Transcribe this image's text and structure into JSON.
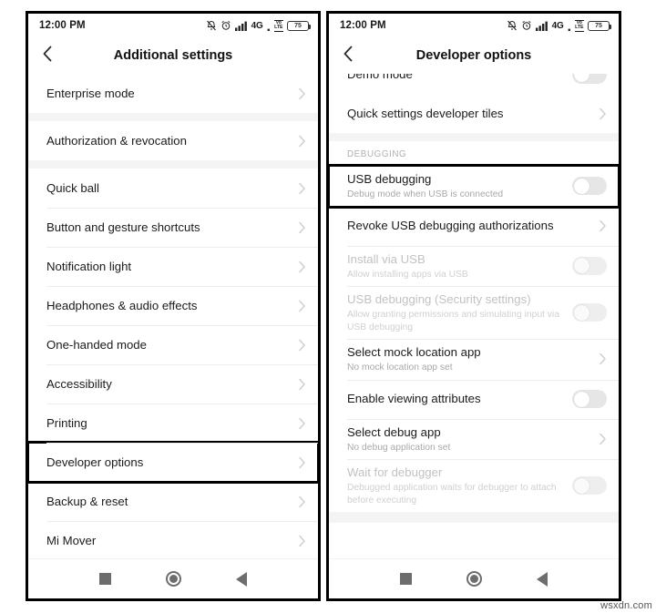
{
  "watermark": "wsxdn.com",
  "status_bar": {
    "time": "12:00 PM",
    "network": "4G",
    "volte_top": "Vo",
    "volte_bottom": "LTE",
    "battery_level": "75",
    "icons": [
      "mute-icon",
      "alarm-icon",
      "signal-bars-icon",
      "volte-icon",
      "battery-icon"
    ]
  },
  "left_phone": {
    "title": "Additional settings",
    "back_label": "Back",
    "groups": [
      {
        "rows": [
          {
            "title": "Enterprise mode",
            "sub": "",
            "accessory": "chevron",
            "disabled": false,
            "highlighted": false
          }
        ]
      },
      {
        "rows": [
          {
            "title": "Authorization & revocation",
            "sub": "",
            "accessory": "chevron",
            "disabled": false,
            "highlighted": false
          }
        ]
      },
      {
        "rows": [
          {
            "title": "Quick ball",
            "sub": "",
            "accessory": "chevron",
            "disabled": false,
            "highlighted": false
          },
          {
            "title": "Button and gesture shortcuts",
            "sub": "",
            "accessory": "chevron",
            "disabled": false,
            "highlighted": false
          },
          {
            "title": "Notification light",
            "sub": "",
            "accessory": "chevron",
            "disabled": false,
            "highlighted": false
          },
          {
            "title": "Headphones & audio effects",
            "sub": "",
            "accessory": "chevron",
            "disabled": false,
            "highlighted": false
          },
          {
            "title": "One-handed mode",
            "sub": "",
            "accessory": "chevron",
            "disabled": false,
            "highlighted": false
          },
          {
            "title": "Accessibility",
            "sub": "",
            "accessory": "chevron",
            "disabled": false,
            "highlighted": false
          },
          {
            "title": "Printing",
            "sub": "",
            "accessory": "chevron",
            "disabled": false,
            "highlighted": false
          },
          {
            "title": "Developer options",
            "sub": "",
            "accessory": "chevron",
            "disabled": false,
            "highlighted": true
          },
          {
            "title": "Backup & reset",
            "sub": "",
            "accessory": "chevron",
            "disabled": false,
            "highlighted": false
          },
          {
            "title": "Mi Mover",
            "sub": "",
            "accessory": "chevron",
            "disabled": false,
            "highlighted": false
          }
        ]
      }
    ]
  },
  "right_phone": {
    "title": "Developer options",
    "back_label": "Back",
    "clipped_top_row": {
      "title": "Demo mode",
      "sub": "",
      "accessory": "switch",
      "switch_on": false,
      "disabled": false
    },
    "groups": [
      {
        "rows": [
          {
            "title": "Quick settings developer tiles",
            "sub": "",
            "accessory": "chevron",
            "disabled": false,
            "highlighted": false
          }
        ]
      },
      {
        "section_header": "DEBUGGING",
        "rows": [
          {
            "title": "USB debugging",
            "sub": "Debug mode when USB is connected",
            "accessory": "switch",
            "switch_on": false,
            "disabled": false,
            "highlighted": true
          },
          {
            "title": "Revoke USB debugging authorizations",
            "sub": "",
            "accessory": "chevron",
            "disabled": false,
            "highlighted": false
          },
          {
            "title": "Install via USB",
            "sub": "Allow installing apps via USB",
            "accessory": "switch",
            "switch_on": false,
            "disabled": true,
            "highlighted": false
          },
          {
            "title": "USB debugging (Security settings)",
            "sub": "Allow granting permissions and simulating input via USB debugging",
            "accessory": "switch",
            "switch_on": false,
            "disabled": true,
            "highlighted": false
          },
          {
            "title": "Select mock location app",
            "sub": "No mock location app set",
            "accessory": "chevron",
            "disabled": false,
            "highlighted": false
          },
          {
            "title": "Enable viewing attributes",
            "sub": "",
            "accessory": "switch",
            "switch_on": false,
            "disabled": false,
            "highlighted": false
          },
          {
            "title": "Select debug app",
            "sub": "No debug application set",
            "accessory": "chevron",
            "disabled": false,
            "highlighted": false
          },
          {
            "title": "Wait for debugger",
            "sub": "Debugged application waits for debugger to attach before executing",
            "accessory": "switch",
            "switch_on": false,
            "disabled": true,
            "highlighted": false
          }
        ]
      }
    ]
  },
  "nav_bar": {
    "recents_label": "Recents",
    "home_label": "Home",
    "back_label": "Back"
  }
}
